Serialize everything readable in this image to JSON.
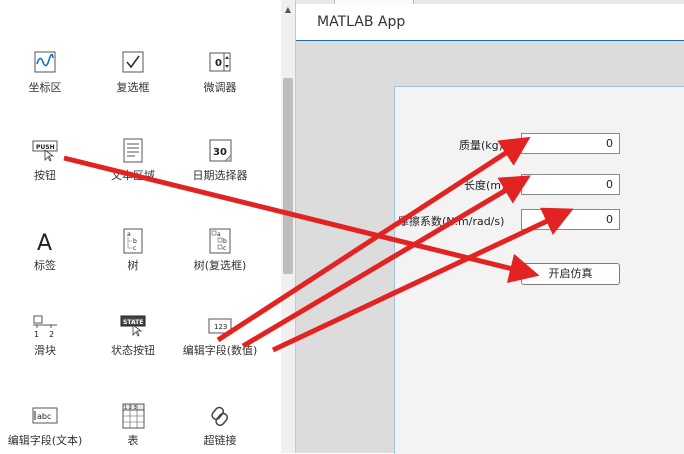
{
  "app_title": "MATLAB App",
  "palette": {
    "items": [
      {
        "label": "坐标区"
      },
      {
        "label": "复选框"
      },
      {
        "label": "微调器",
        "icon_text": "0"
      },
      {
        "label": "按钮",
        "icon_text": "PUSH"
      },
      {
        "label": "文本区域"
      },
      {
        "label": "日期选择器",
        "icon_text": "30"
      },
      {
        "label": "标签",
        "icon_text": "A"
      },
      {
        "label": "树",
        "icon_text": "a\nb\nc"
      },
      {
        "label": "树(复选框)",
        "icon_text": "a\nb\nc"
      },
      {
        "label": "滑块",
        "icon_text": "1   2"
      },
      {
        "label": "状态按钮",
        "icon_text": "STATE"
      },
      {
        "label": "编辑字段(数值)",
        "icon_text": "123"
      },
      {
        "label": "编辑字段(文本)",
        "icon_text": "abc"
      },
      {
        "label": "表",
        "icon_text": "1 2 3"
      },
      {
        "label": "超链接"
      }
    ]
  },
  "form": {
    "mass_label": "质量(kg)",
    "mass_value": "0",
    "length_label": "长度(m)",
    "length_value": "0",
    "friction_label": "摩擦系数(N.m/rad/s)",
    "friction_value": "0",
    "start_button": "开启仿真"
  },
  "colors": {
    "arrow": "#e32222",
    "selection": "#1f6fb5"
  }
}
